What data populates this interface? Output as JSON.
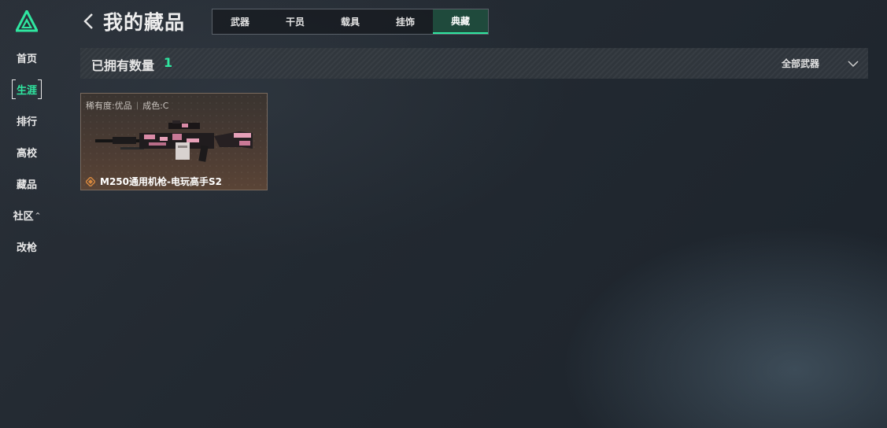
{
  "sidebar": {
    "items": [
      {
        "label": "首页"
      },
      {
        "label": "生涯"
      },
      {
        "label": "排行"
      },
      {
        "label": "高校"
      },
      {
        "label": "藏品"
      },
      {
        "label": "社区"
      },
      {
        "label": "改枪"
      }
    ],
    "community_caret": "^"
  },
  "header": {
    "title": "我的藏品",
    "tabs": [
      {
        "label": "武器"
      },
      {
        "label": "干员"
      },
      {
        "label": "载具"
      },
      {
        "label": "挂饰"
      },
      {
        "label": "典藏"
      }
    ]
  },
  "filter_bar": {
    "owned_label": "已拥有数量",
    "owned_count": "1",
    "weapon_filter": "全部武器"
  },
  "items": [
    {
      "rarity": "稀有度:优品",
      "separator": "|",
      "condition": "成色:C",
      "name": "M250通用机枪-电玩高手S2"
    }
  ],
  "colors": {
    "accent": "#2fe6a0",
    "active_tab_bg": "#1f4a3c",
    "card_border": "#7a6a5e",
    "rarity_icon": "#d9893e"
  },
  "icons": {
    "logo": "triangle-logo-icon",
    "back": "back-arrow-icon",
    "filter": "chevron-down-icon",
    "rarity": "diamond-icon"
  }
}
